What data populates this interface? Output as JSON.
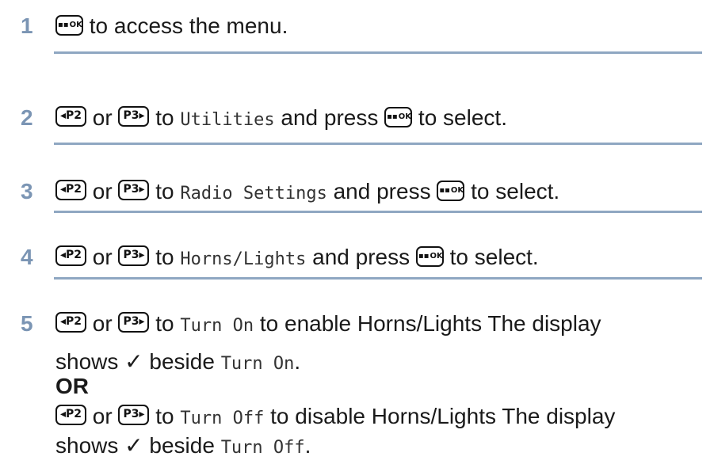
{
  "keys": {
    "ok": "OK",
    "ok_grid": "▪▪",
    "p2": "◂P2",
    "p3": "P3▸"
  },
  "steps": [
    {
      "num": "1",
      "text": "to access the menu."
    },
    {
      "num": "2",
      "or": "or",
      "to": "to",
      "target": "Utilities",
      "after": "and press",
      "end": "to select."
    },
    {
      "num": "3",
      "or": "or",
      "to": "to",
      "target": "Radio Settings",
      "after": "and press",
      "end": "to select."
    },
    {
      "num": "4",
      "or": "or",
      "to": "to",
      "target": "Horns/Lights",
      "after": "and press",
      "end": "to select."
    },
    {
      "num": "5",
      "or": "or",
      "to": "to",
      "target_on": "Turn On",
      "enable_text": "to enable Horns/Lights The display",
      "shows": "shows ✓ beside",
      "or_label": "OR",
      "target_off": "Turn Off",
      "disable_text": "to disable Horns/Lights The display",
      "period": "."
    }
  ]
}
